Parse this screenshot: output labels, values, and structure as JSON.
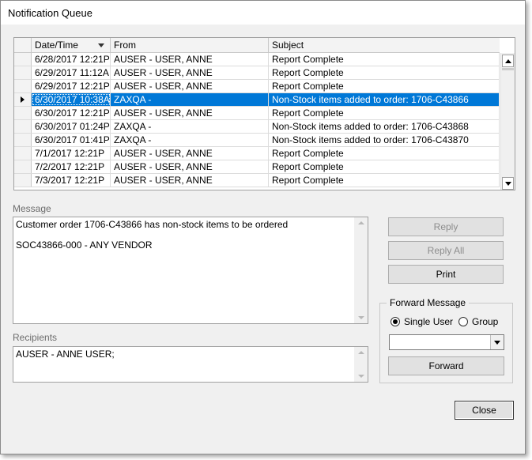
{
  "window": {
    "title": "Notification Queue"
  },
  "grid": {
    "columns": [
      "Date/Time",
      "From",
      "Subject"
    ],
    "selected_index": 3,
    "rows": [
      {
        "datetime": "6/28/2017 12:21P",
        "from": "AUSER - USER, ANNE",
        "subject": "Report Complete"
      },
      {
        "datetime": "6/29/2017 11:12A",
        "from": "AUSER - USER, ANNE",
        "subject": "Report Complete"
      },
      {
        "datetime": "6/29/2017 12:21P",
        "from": "AUSER - USER, ANNE",
        "subject": "Report Complete"
      },
      {
        "datetime": "6/30/2017 10:38A",
        "from": "ZAXQA -",
        "subject": "Non-Stock items added to order: 1706-C43866"
      },
      {
        "datetime": "6/30/2017 12:21P",
        "from": "AUSER - USER, ANNE",
        "subject": "Report Complete"
      },
      {
        "datetime": "6/30/2017 01:24P",
        "from": "ZAXQA -",
        "subject": "Non-Stock items added to order: 1706-C43868"
      },
      {
        "datetime": "6/30/2017 01:41P",
        "from": "ZAXQA -",
        "subject": "Non-Stock items added to order: 1706-C43870"
      },
      {
        "datetime": "7/1/2017 12:21P",
        "from": "AUSER - USER, ANNE",
        "subject": "Report Complete"
      },
      {
        "datetime": "7/2/2017 12:21P",
        "from": "AUSER - USER, ANNE",
        "subject": "Report Complete"
      },
      {
        "datetime": "7/3/2017 12:21P",
        "from": "AUSER - USER, ANNE",
        "subject": "Report Complete"
      }
    ]
  },
  "message": {
    "label": "Message",
    "text": "Customer order 1706-C43866 has non-stock items to be ordered\n\nSOC43866-000 - ANY VENDOR"
  },
  "recipients": {
    "label": "Recipients",
    "text": "AUSER - ANNE USER;"
  },
  "buttons": {
    "reply": "Reply",
    "reply_all": "Reply All",
    "print": "Print",
    "forward": "Forward",
    "close": "Close"
  },
  "forward": {
    "legend": "Forward Message",
    "single_user": "Single User",
    "group": "Group",
    "selected": "single_user",
    "combo_value": ""
  }
}
